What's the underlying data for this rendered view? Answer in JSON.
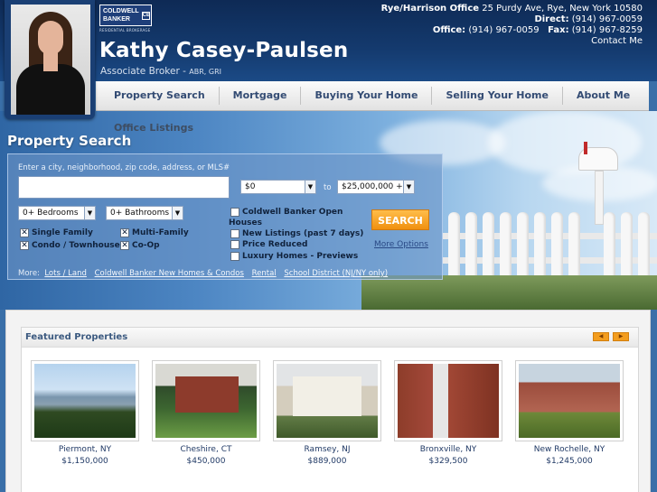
{
  "agent": {
    "name": "Kathy Casey-Paulsen",
    "title": "Associate Broker -",
    "credentials": "ABR, GRI"
  },
  "brand": {
    "line1": "COLDWELL",
    "line2": "BANKER",
    "mark": "CB",
    "sub": "RESIDENTIAL BROKERAGE"
  },
  "contact": {
    "office_label": "Rye/Harrison Office",
    "office_address": "25 Purdy Ave, Rye, New York 10580",
    "direct_label": "Direct:",
    "direct_phone": "(914) 967-0059",
    "office_phone_label": "Office:",
    "office_phone": "(914) 967-0059",
    "fax_label": "Fax:",
    "fax": "(914) 967-8259",
    "contact_link": "Contact Me"
  },
  "nav": {
    "items": [
      "Property Search",
      "Mortgage",
      "Buying Your Home",
      "Selling Your Home",
      "About Me"
    ],
    "sub_item": "Office Listings"
  },
  "search": {
    "title": "Property Search",
    "hint": "Enter a city, neighborhood, zip code, address, or MLS#",
    "input_value": "",
    "price_min": "$0",
    "price_to": "to",
    "price_max": "$25,000,000 +",
    "bedrooms": "0+ Bedrooms",
    "bathrooms": "0+ Bathrooms",
    "types": [
      {
        "label": "Single Family",
        "checked": true
      },
      {
        "label": "Multi-Family",
        "checked": true
      },
      {
        "label": "Condo / Townhouse",
        "checked": true
      },
      {
        "label": "Co-Op",
        "checked": true
      }
    ],
    "filters": [
      {
        "label": "Coldwell Banker Open",
        "label2": "Houses",
        "checked": false
      },
      {
        "label": "New Listings (past 7 days)",
        "checked": false
      },
      {
        "label": "Price Reduced",
        "checked": false
      },
      {
        "label": "Luxury Homes - Previews",
        "checked": false
      }
    ],
    "search_button": "SEARCH",
    "more_options": "More Options",
    "more_label": "More:",
    "more_links": [
      "Lots / Land",
      "Coldwell Banker New Homes & Condos",
      "Rental",
      "School District (NJ/NY only)"
    ]
  },
  "featured": {
    "title": "Featured Properties",
    "properties": [
      {
        "city": "Piermont, NY",
        "price": "$1,150,000"
      },
      {
        "city": "Cheshire, CT",
        "price": "$450,000"
      },
      {
        "city": "Ramsey, NJ",
        "price": "$889,000"
      },
      {
        "city": "Bronxville, NY",
        "price": "$329,500"
      },
      {
        "city": "New Rochelle, NY",
        "price": "$1,245,000"
      }
    ]
  },
  "colors": {
    "header_bg": "#143a6e",
    "nav_text": "#334b73",
    "search_button": "#f0900f",
    "link_blue": "#213a66"
  }
}
